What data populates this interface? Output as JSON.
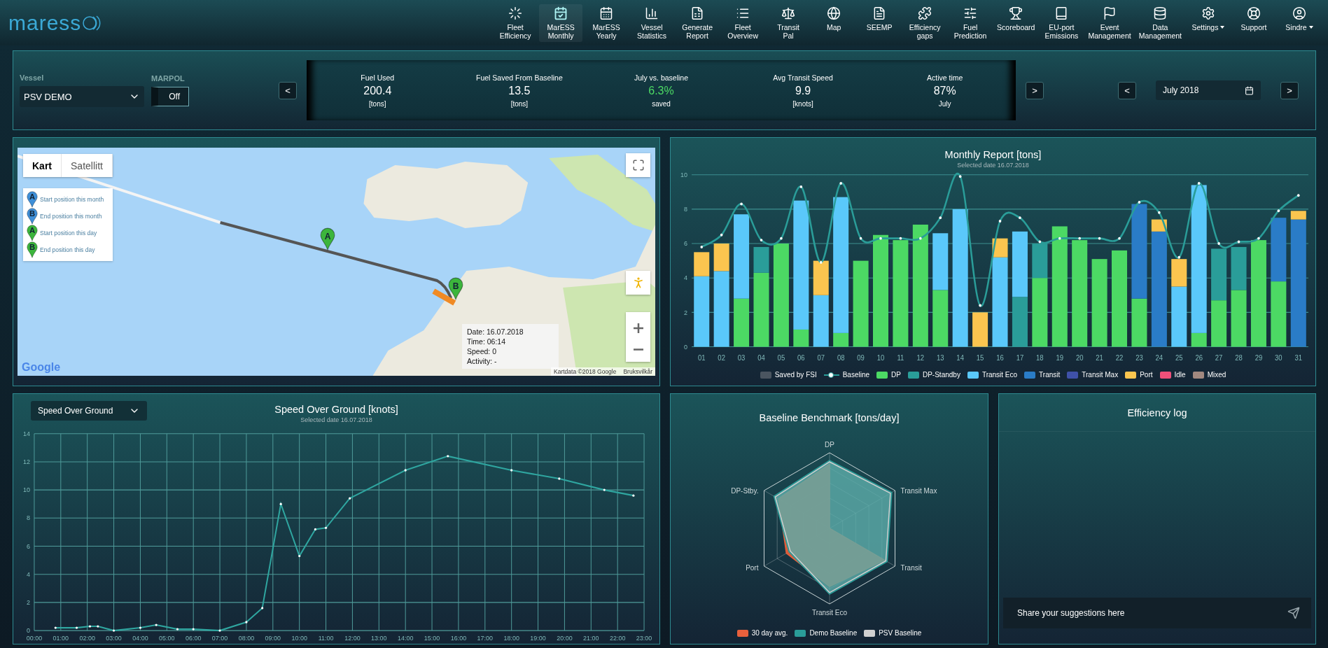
{
  "logo": "maress",
  "nav": {
    "items": [
      {
        "label": "Fleet\nEfficiency",
        "selected": false,
        "dropdown": false
      },
      {
        "label": "MarESS\nMonthly",
        "selected": true,
        "dropdown": false
      },
      {
        "label": "MarESS\nYearly",
        "selected": false,
        "dropdown": false
      },
      {
        "label": "Vessel\nStatistics",
        "selected": false,
        "dropdown": false
      },
      {
        "label": "Generate\nReport",
        "selected": false,
        "dropdown": false
      },
      {
        "label": "Fleet\nOverview",
        "selected": false,
        "dropdown": false
      },
      {
        "label": "Transit\nPal",
        "selected": false,
        "dropdown": false
      },
      {
        "label": "Map",
        "selected": false,
        "dropdown": false
      },
      {
        "label": "SEEMP",
        "selected": false,
        "dropdown": false
      },
      {
        "label": "Efficiency\ngaps",
        "selected": false,
        "dropdown": false
      },
      {
        "label": "Fuel\nPrediction",
        "selected": false,
        "dropdown": false
      },
      {
        "label": "Scoreboard",
        "selected": false,
        "dropdown": false
      },
      {
        "label": "EU-port\nEmissions",
        "selected": false,
        "dropdown": false
      },
      {
        "label": "Event\nManagement",
        "selected": false,
        "dropdown": false
      },
      {
        "label": "Data\nManagement",
        "selected": false,
        "dropdown": false
      },
      {
        "label": "Settings",
        "selected": false,
        "dropdown": true
      },
      {
        "label": "Support",
        "selected": false,
        "dropdown": false
      },
      {
        "label": "Sindre",
        "selected": false,
        "dropdown": true
      }
    ]
  },
  "summary": {
    "vessel": {
      "label": "Vessel",
      "value": "PSV DEMO"
    },
    "marpol": {
      "label": "MARPOL",
      "value": "Off",
      "on": false
    },
    "prev": "<",
    "next": ">",
    "kpis": [
      {
        "label": "Fuel Used",
        "value": "200.4",
        "unit": "[tons]",
        "highlight": false
      },
      {
        "label": "Fuel Saved From Baseline",
        "value": "13.5",
        "unit": "[tons]",
        "highlight": false
      },
      {
        "label": "July vs. baseline",
        "value": "6.3%",
        "unit": "saved",
        "highlight": true
      },
      {
        "label": "Avg Transit Speed",
        "value": "9.9",
        "unit": "[knots]",
        "highlight": false
      },
      {
        "label": "Active time",
        "value": "87%",
        "unit": "July",
        "highlight": false
      }
    ],
    "date": {
      "prev": "<",
      "value": "July 2018",
      "next": ">"
    }
  },
  "map": {
    "tabs": [
      {
        "label": "Kart",
        "selected": true
      },
      {
        "label": "Satellitt",
        "selected": false
      }
    ],
    "legend": [
      {
        "letter": "A",
        "label": "Start position this month",
        "color": "#3f8fd8"
      },
      {
        "letter": "B",
        "label": "End position this month",
        "color": "#3f8fd8"
      },
      {
        "letter": "A",
        "label": "Start position this day",
        "color": "#3cb53c"
      },
      {
        "letter": "B",
        "label": "End position this day",
        "color": "#3cb53c"
      }
    ],
    "markers": [
      {
        "letter": "A"
      },
      {
        "letter": "B"
      }
    ],
    "tooltip": [
      "Date: 16.07.2018",
      "Time: 06:14",
      "Speed: 0",
      "Activity: -"
    ],
    "logo": "Google",
    "attribution": "Kartdata ©2018 Google",
    "terms": "Bruksvilkår"
  },
  "monthly": {
    "subtitle": "Selected date 16.07.2018",
    "chart_data": {
      "type": "bar",
      "title": "Monthly Report [tons]",
      "stacked": true,
      "categories": [
        "01",
        "02",
        "03",
        "04",
        "05",
        "06",
        "07",
        "08",
        "09",
        "10",
        "11",
        "12",
        "13",
        "14",
        "15",
        "16",
        "17",
        "18",
        "19",
        "20",
        "21",
        "22",
        "23",
        "24",
        "25",
        "26",
        "27",
        "28",
        "29",
        "30",
        "31"
      ],
      "ylim": [
        0,
        10
      ],
      "yticks": [
        0,
        2,
        4,
        6,
        8,
        10
      ],
      "grid": true,
      "series": [
        {
          "name": "Saved by FSI",
          "color": "#4a5560",
          "values": [
            0,
            0,
            0,
            0,
            0,
            0,
            0,
            0,
            0,
            0,
            0,
            0,
            0,
            0,
            0,
            0,
            0,
            0,
            0,
            0,
            0,
            0,
            0,
            0,
            0,
            0,
            0,
            0,
            0,
            0,
            0
          ]
        },
        {
          "name": "Baseline",
          "color": "#2a9d99",
          "type": "line",
          "values": [
            5.8,
            6.5,
            8.3,
            6.2,
            6.3,
            9.3,
            4.9,
            9.5,
            6.3,
            6.3,
            6.3,
            6.3,
            7.5,
            9.9,
            2.4,
            7.3,
            7.5,
            6.1,
            6.3,
            6.3,
            6.3,
            6.3,
            8.4,
            7.8,
            5.2,
            9.5,
            6.0,
            6.1,
            6.3,
            7.9,
            8.8
          ]
        },
        {
          "name": "DP",
          "color": "#4cd964",
          "values": [
            0,
            0,
            2.8,
            4.3,
            6.0,
            1.0,
            0,
            0.8,
            5.0,
            6.5,
            6.2,
            7.1,
            3.3,
            0,
            0,
            0,
            0,
            4.0,
            7.0,
            6.2,
            5.1,
            5.6,
            2.8,
            0,
            0,
            0.8,
            2.7,
            3.3,
            6.2,
            3.8,
            0
          ]
        },
        {
          "name": "DP-Standby",
          "color": "#2a9d99",
          "values": [
            0,
            0,
            0,
            1.5,
            0,
            0,
            0,
            0,
            0,
            0,
            0,
            0,
            0,
            0,
            0,
            0,
            2.9,
            2.0,
            0,
            0,
            0,
            0,
            0,
            0,
            0,
            0,
            3.0,
            2.5,
            0,
            0,
            0
          ]
        },
        {
          "name": "Transit Eco",
          "color": "#5ac8fa",
          "values": [
            4.1,
            4.4,
            4.9,
            0,
            0,
            7.5,
            3.0,
            7.9,
            0,
            0,
            0,
            0,
            3.3,
            8.0,
            0,
            5.2,
            3.8,
            0,
            0,
            0,
            0,
            0,
            0,
            0,
            3.5,
            8.6,
            0,
            0,
            0,
            0,
            0
          ]
        },
        {
          "name": "Transit",
          "color": "#2a7cc7",
          "values": [
            0,
            0,
            0,
            0,
            0,
            0,
            0,
            0,
            0,
            0,
            0,
            0,
            0,
            0,
            0,
            0,
            0,
            0,
            0,
            0,
            0,
            0,
            5.5,
            6.7,
            0,
            0,
            0,
            0,
            0,
            3.7,
            7.4
          ]
        },
        {
          "name": "Transit Max",
          "color": "#3f51a8",
          "values": [
            0,
            0,
            0,
            0,
            0,
            0,
            0,
            0,
            0,
            0,
            0,
            0,
            0,
            0,
            0,
            0,
            0,
            0,
            0,
            0,
            0,
            0,
            0,
            0,
            0,
            0,
            0,
            0,
            0,
            0,
            0
          ]
        },
        {
          "name": "Port",
          "color": "#fbc54f",
          "values": [
            1.4,
            1.6,
            0,
            0,
            0,
            0,
            2.0,
            0,
            0,
            0,
            0,
            0,
            0,
            0,
            2.0,
            1.1,
            0,
            0,
            0,
            0,
            0,
            0,
            0,
            0.7,
            1.6,
            0,
            0,
            0,
            0,
            0,
            0.5
          ]
        },
        {
          "name": "Idle",
          "color": "#f0507a",
          "values": [
            0,
            0,
            0,
            0,
            0,
            0,
            0,
            0,
            0,
            0,
            0,
            0,
            0,
            0,
            0,
            0,
            0,
            0,
            0,
            0,
            0,
            0,
            0,
            0,
            0,
            0,
            0,
            0,
            0,
            0,
            0
          ]
        },
        {
          "name": "Mixed",
          "color": "#a1887f",
          "values": [
            0,
            0,
            0,
            0,
            0,
            0,
            0,
            0,
            0,
            0,
            0,
            0,
            0,
            0,
            0,
            0,
            0,
            0,
            0,
            0,
            0,
            0,
            0,
            0,
            0,
            0,
            0,
            0,
            0,
            0,
            0
          ]
        }
      ]
    }
  },
  "speed": {
    "subtitle": "Selected date 16.07.2018",
    "chart_data": {
      "type": "line",
      "title": "Speed Over Ground [knots]",
      "x": [
        0.8,
        1.6,
        2.1,
        2.4,
        3.0,
        4.0,
        4.6,
        5.4,
        6.0,
        7.0,
        8.0,
        8.6,
        9.3,
        10.0,
        10.6,
        11.0,
        11.9,
        14.0,
        15.6,
        18.0,
        19.8,
        21.5,
        22.6
      ],
      "series": [
        {
          "name": "Speed Over Ground",
          "color": "#2fa6a0",
          "values": [
            0.2,
            0.2,
            0.3,
            0.3,
            0.0,
            0.2,
            0.4,
            0.1,
            0.1,
            0.0,
            0.6,
            1.6,
            9.0,
            5.3,
            7.2,
            7.3,
            9.4,
            11.4,
            12.4,
            11.4,
            10.8,
            10.0,
            9.6
          ]
        }
      ],
      "xlim": [
        0,
        23
      ],
      "ylim": [
        0,
        14
      ],
      "grid": true,
      "yticks": [
        0,
        2,
        4,
        6,
        8,
        10,
        12,
        14
      ],
      "xticks": [
        {
          "value": 0,
          "label": "00:00"
        },
        {
          "value": 1,
          "label": "01:00"
        },
        {
          "value": 2,
          "label": "02:00"
        },
        {
          "value": 3,
          "label": "03:00"
        },
        {
          "value": 4,
          "label": "04:00"
        },
        {
          "value": 5,
          "label": "05:00"
        },
        {
          "value": 6,
          "label": "06:00"
        },
        {
          "value": 7,
          "label": "07:00"
        },
        {
          "value": 8,
          "label": "08:00"
        },
        {
          "value": 9,
          "label": "09:00"
        },
        {
          "value": 10,
          "label": "10:00"
        },
        {
          "value": 11,
          "label": "11:00"
        },
        {
          "value": 12,
          "label": "12:00"
        },
        {
          "value": 13,
          "label": "13:00"
        },
        {
          "value": 14,
          "label": "14:00"
        },
        {
          "value": 15,
          "label": "15:00"
        },
        {
          "value": 16,
          "label": "16:00"
        },
        {
          "value": 17,
          "label": "17:00"
        },
        {
          "value": 18,
          "label": "18:00"
        },
        {
          "value": 19,
          "label": "19:00"
        },
        {
          "value": 20,
          "label": "20:00"
        },
        {
          "value": 21,
          "label": "21:00"
        },
        {
          "value": 22,
          "label": "22:00"
        },
        {
          "value": 23,
          "label": "23:00"
        }
      ]
    }
  },
  "benchmark": {
    "title": "Baseline Benchmark [tons/day]",
    "axes": [
      "DP",
      "Transit Max",
      "Transit",
      "Transit Eco",
      "Port",
      "DP-Stby."
    ],
    "legend": [
      {
        "label": "30 day avg.",
        "color": "#e8603c"
      },
      {
        "label": "Demo Baseline",
        "color": "#2a9d99"
      },
      {
        "label": "PSV Baseline",
        "color": "#d0d0d0"
      }
    ]
  },
  "log": {
    "title": "Efficiency log",
    "placeholder": "Share your suggestions here"
  }
}
